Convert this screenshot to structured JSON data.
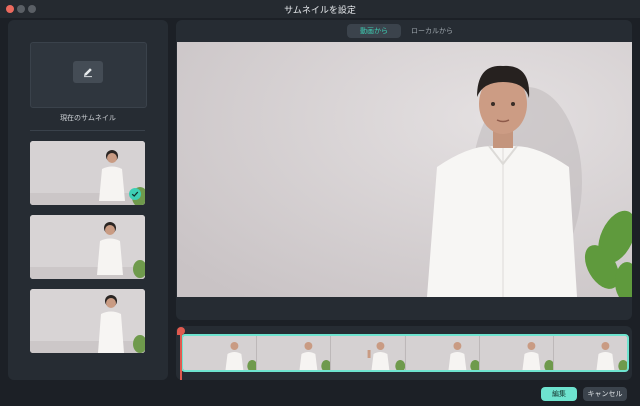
{
  "window": {
    "title": "サムネイルを設定"
  },
  "left_panel": {
    "current_label": "現在のサムネイル",
    "thumbnails": [
      {
        "selected": true
      },
      {
        "selected": false
      },
      {
        "selected": false
      }
    ]
  },
  "tabs": [
    {
      "label": "動画から",
      "active": true
    },
    {
      "label": "ローカルから",
      "active": false
    }
  ],
  "buttons": {
    "edit": "編集",
    "cancel": "キャンセル"
  },
  "colors": {
    "accent": "#6ee3cf",
    "playhead": "#e05a4f",
    "panel": "#262c33",
    "background": "#1c2026"
  }
}
